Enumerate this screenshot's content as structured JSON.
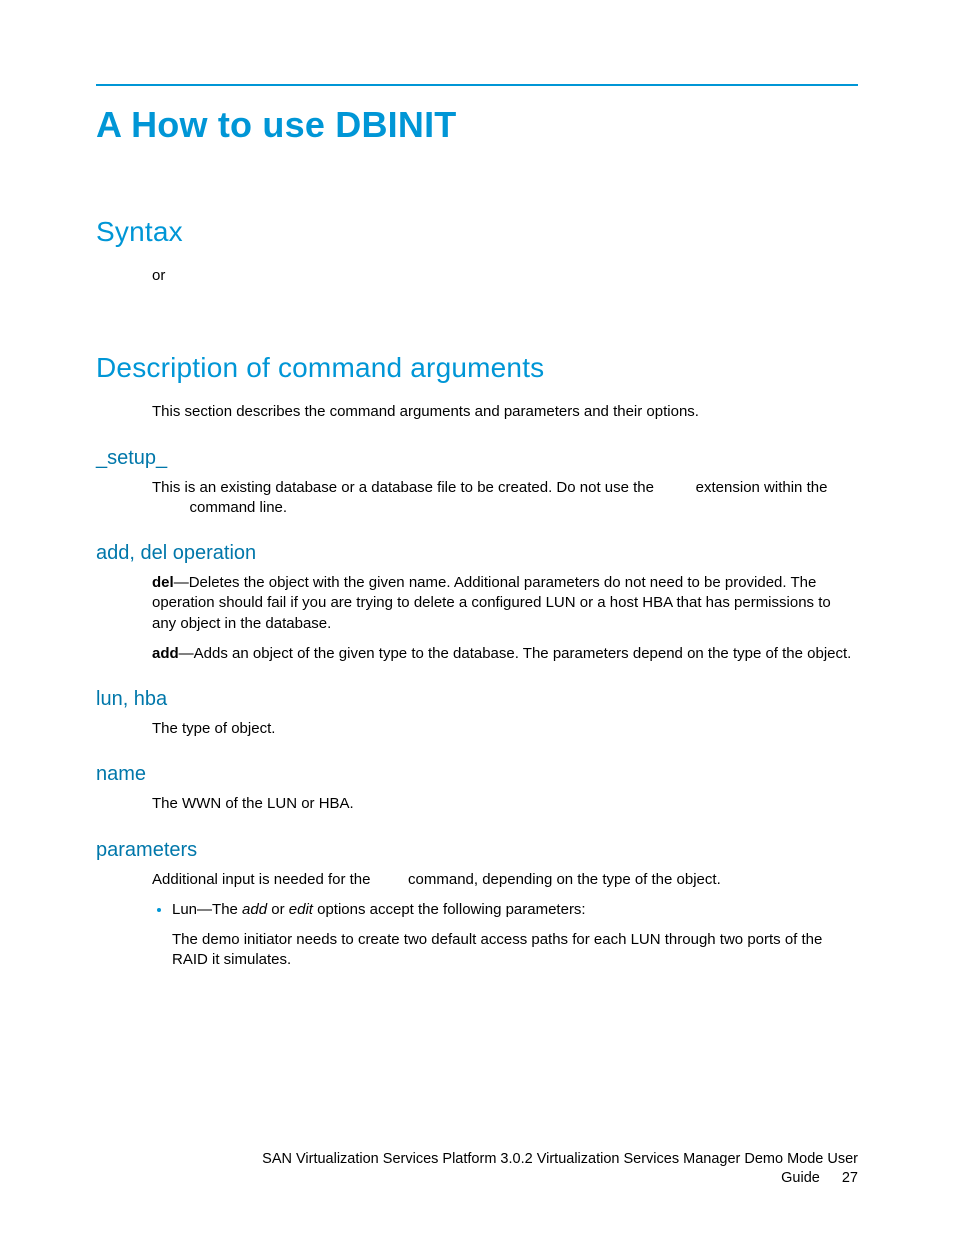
{
  "title": "A How to use DBINIT",
  "syntax": {
    "heading": "Syntax",
    "or": "or"
  },
  "desc": {
    "heading": "Description of command arguments",
    "intro": "This section describes the command arguments and parameters and their options."
  },
  "setup": {
    "heading": "_setup_",
    "text_a": "This is an existing database or a database file to be created. Do not use the",
    "text_b": "extension within the",
    "text_c": "command line."
  },
  "adddel": {
    "heading": "add, del operation",
    "del_label": "del",
    "del_text": "—Deletes the object with the given name. Additional parameters do not need to be provided. The operation should fail if you are trying to delete a configured LUN or a host HBA that has permissions to any object in the database.",
    "add_label": "add",
    "add_text": "—Adds an object of the given type to the database. The parameters depend on the type of the object."
  },
  "lunhba": {
    "heading": "lun, hba",
    "text": "The type of object."
  },
  "name": {
    "heading": "name",
    "text": "The WWN of the LUN or HBA."
  },
  "parameters": {
    "heading": "parameters",
    "intro_a": "Additional input is needed for the",
    "intro_b": "command, depending on the type of the object.",
    "bullet_a": "Lun—The ",
    "bullet_add": "add",
    "bullet_or": " or ",
    "bullet_edit": "edit",
    "bullet_b": " options accept the following parameters:",
    "sub": "The demo initiator needs to create two default access paths for each LUN through two ports of the RAID it simulates."
  },
  "footer": {
    "line1": "SAN Virtualization Services Platform 3.0.2 Virtualization Services Manager Demo Mode User",
    "line2": "Guide",
    "page": "27"
  }
}
